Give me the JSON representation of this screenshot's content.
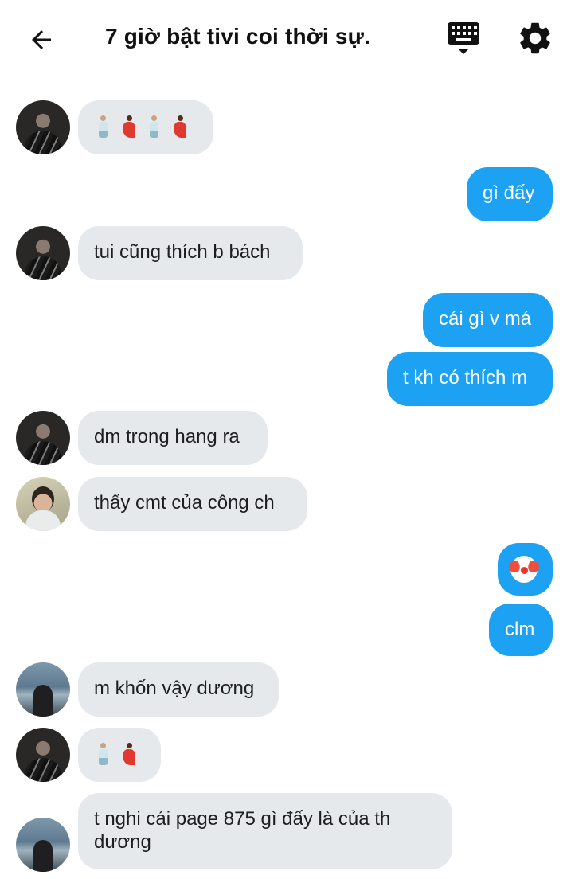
{
  "header": {
    "title": "7 giờ bật tivi coi thời sự."
  },
  "icons": {
    "back": "arrow-left-icon",
    "keyboard": "keyboard-icon",
    "settings": "gear-icon"
  },
  "colors": {
    "outgoing_bubble": "#1da1f2",
    "incoming_bubble": "#e6e9ec"
  },
  "messages": [
    {
      "side": "in",
      "emoji": [
        "man-dancing",
        "woman-dancing",
        "man-dancing",
        "woman-dancing"
      ]
    },
    {
      "side": "out",
      "text": "gì đấy"
    },
    {
      "side": "in",
      "text": "tui cũng thích b bách"
    },
    {
      "side": "out",
      "text": "cái gì v má"
    },
    {
      "side": "out",
      "text": "t kh có thích m"
    },
    {
      "side": "in",
      "text": "dm trong hang ra"
    },
    {
      "side": "in",
      "text": "thấy cmt của công ch"
    },
    {
      "side": "out",
      "emoji": [
        "clown-face"
      ]
    },
    {
      "side": "out",
      "text": "clm"
    },
    {
      "side": "in",
      "text": "m khốn vậy dương"
    },
    {
      "side": "in",
      "emoji": [
        "man-dancing",
        "woman-dancing"
      ]
    },
    {
      "side": "in",
      "lines": [
        "t nghi cái page 875 gì đấy là của th",
        "dương"
      ]
    }
  ]
}
